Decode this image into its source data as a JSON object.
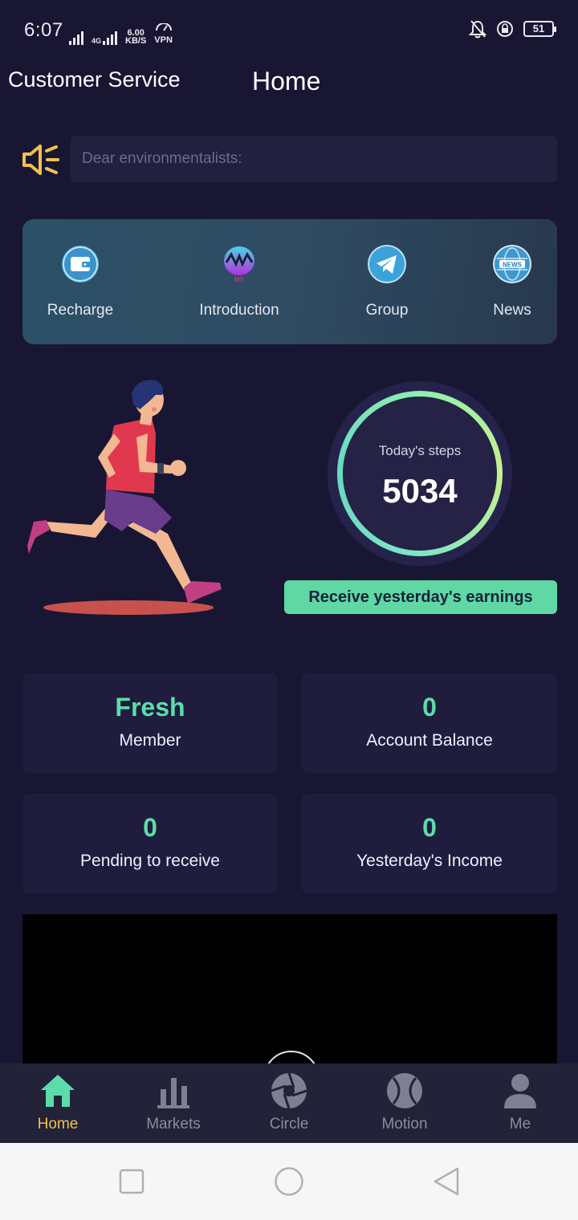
{
  "status_bar": {
    "time": "6:07",
    "network_type": "4G",
    "speed_value": "6.00",
    "speed_unit": "KB/S",
    "vpn": "VPN",
    "battery": "51"
  },
  "header": {
    "customer_service": "Customer Service",
    "title": "Home"
  },
  "notice": {
    "text": "Dear environmentalists:"
  },
  "quick_menu": [
    {
      "label": "Recharge",
      "icon": "wallet-icon"
    },
    {
      "label": "Introduction",
      "icon": "ms-logo-icon"
    },
    {
      "label": "Group",
      "icon": "telegram-icon"
    },
    {
      "label": "News",
      "icon": "news-globe-icon"
    }
  ],
  "steps": {
    "label": "Today's steps",
    "value": "5034"
  },
  "earnings_button": "Receive yesterday's earnings",
  "stats": [
    {
      "value": "Fresh",
      "label": "Member"
    },
    {
      "value": "0",
      "label": "Account Balance"
    },
    {
      "value": "0",
      "label": "Pending to receive"
    },
    {
      "value": "0",
      "label": "Yesterday's Income"
    }
  ],
  "tabs": [
    {
      "label": "Home",
      "icon": "home-icon",
      "active": true
    },
    {
      "label": "Markets",
      "icon": "bar-chart-icon",
      "active": false
    },
    {
      "label": "Circle",
      "icon": "aperture-icon",
      "active": false
    },
    {
      "label": "Motion",
      "icon": "ball-icon",
      "active": false
    },
    {
      "label": "Me",
      "icon": "user-icon",
      "active": false
    }
  ],
  "colors": {
    "background": "#191634",
    "accent_green": "#5cdcaa",
    "active_tab": "#f1c14b",
    "speaker": "#f1c14b"
  }
}
